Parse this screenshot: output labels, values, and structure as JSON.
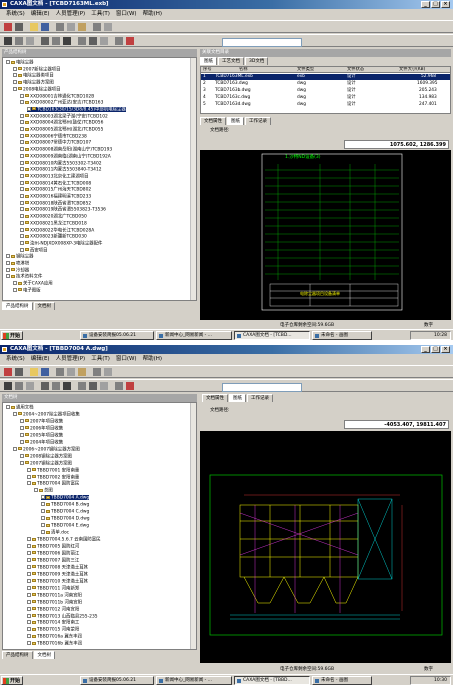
{
  "s1": {
    "title": "CAXA图文档 - [TCBD7163ML.exb]",
    "menu": [
      "系统(S)",
      "编辑(E)",
      "人员管理(P)",
      "工具(T)",
      "窗口(W)",
      "帮助(H)"
    ],
    "tree_title": "产品结构树",
    "tree": [
      "电除尘器",
      "2007新除尘器项目",
      "电除尘器类项目",
      "电除尘器方案图",
      "2008电除尘器项目",
      "XXD08001吉林通化TCBD102B",
      "XXD08002广州亚达(安吉)TCBD163",
      "TCBD163(30/15/3D8/8.45)中部机电除尘器",
      "XXD08003湖北梁子湖(宁安)TCBD102",
      "XXD08004湖北鄂州(鼓仗)TCBD056",
      "XXD08005湖北鄂州(湖北)TCBD055",
      "XXD08006宁德市TCBD238",
      "XXD08007常德中力TCBD107",
      "XXD08008湖南岳阳(湖南山宁)TCBD193",
      "XXD08009湖南临(湖南山宁)TCBD192A",
      "XXD08010内蒙古5503302-T3402",
      "XXD08011内蒙古5503840-T3412",
      "XXD08013北京化工建湖项目",
      "XXD08014黄石化工TCBD008",
      "XXD08015广州海天TCBD802",
      "XXD08016福建明溪TCBD233",
      "XXD08018陕西省渭TCBD852",
      "XXD08019陕西省渭5503823-T3536",
      "XXD08020湖北广TCBD050",
      "XXD08021黑龙江TCBD018",
      "XXD08022华电长江TCBD028A",
      "XXD08023新疆新TCBD030",
      "汝州-NDJXDX008XP-3电除尘器配件",
      "西安项目",
      "钢除尘器",
      "喷淋塔",
      "冷却器",
      "技术资料文件",
      "关于CAXA应用",
      "电子图版"
    ],
    "btabs": [
      "产品结构树",
      "文档树"
    ],
    "pane_title": "关联文档目录",
    "tabs_top": [
      "图纸",
      "工艺文档",
      "3D文档"
    ],
    "cols": [
      "序号",
      "名称",
      "文件类型",
      "文件状态",
      "文件大小(KB)"
    ],
    "rows": [
      [
        "1",
        "TCBD7163ML.exb",
        "exb",
        "设计",
        "52.968"
      ],
      [
        "2",
        "TCBD7163.dwg",
        "dwg",
        "设计",
        "1609.395"
      ],
      [
        "3",
        "TCBD7163b.dwg",
        "dwg",
        "设计",
        "205.243"
      ],
      [
        "4",
        "TCBD7163c.dwg",
        "dwg",
        "设计",
        "134.983"
      ],
      [
        "5",
        "TCBD7163d.dwg",
        "dwg",
        "设计",
        "247.401"
      ]
    ],
    "view_tabs": [
      "文档属性",
      "图纸",
      "工作记录"
    ],
    "path_label": "文档路径:",
    "coord": "1075.602, 1286.399",
    "drawing_title": "1.沙特ND设备(3)",
    "drawing_sub": "电除尘器项目设备清单",
    "status": "电子仓库剩余空间:59.6GB",
    "capslock": "数字",
    "taskbar": {
      "start": "开始",
      "tasks": [
        "设备安装简报05.06.21",
        "新闻中心_网易新闻 - ...",
        "CAXA图文档 - [TCBD...",
        "未命名 - 画图"
      ],
      "time": "10:28"
    }
  },
  "s2": {
    "title": "CAXA图文档 - [TBBD7004 A.dwg]",
    "menu": [
      "系统(S)",
      "编辑(E)",
      "人员管理(P)",
      "工具(T)",
      "窗口(W)",
      "帮助(H)"
    ],
    "tree_title": "文档树",
    "tree": [
      "通用文档",
      "2004~2007除尘器项目收集",
      "2007年项目收集",
      "2006年项目收集",
      "2005年项目收集",
      "2004年项目收集",
      "2006~2007钢除尘器方案图",
      "2008钢除尘器方案图",
      "2007钢除尘器方案图",
      "TBBD7001 安阳南重",
      "TBBD7002 安阳南重",
      "TBBD7004 国防富民",
      "总图",
      "TBBD7004 A.dwg",
      "TBBD7004 B.dwg",
      "TBBD7004 C.dwg",
      "TBBD7004 D.dwg",
      "TBBD7004 E.dwg",
      "清单.doc",
      "TBBD7004.5.6.7 云南国防富民",
      "TBBD7005 国防红河",
      "TBBD7006 国防丽江",
      "TBBD7007 国防三江",
      "TBBD7008 天津渤土耳其",
      "TBBD7009 天津渤土耳其",
      "TBBD7010 天津渤土耳其",
      "TBBD7011 河南新郑",
      "TBBD7011a 河南宜阳",
      "TBBD7011b 河南宜阳",
      "TBBD7012 河南宜阳",
      "TBBD7013 山西临县255-235",
      "TBBD7014 安阳南工",
      "TBBD7015 河南荥阳",
      "TBBD7016a 冀东丰润",
      "TBBD7016b 冀东丰润"
    ],
    "btabs": [
      "产品结构树",
      "文档树"
    ],
    "view_tabs": [
      "文档属性",
      "图纸",
      "工作记录"
    ],
    "path_label": "文档路径:",
    "coord": "-4053.407, 19811.407",
    "status": "电子仓库剩余空间:59.6GB",
    "capslock": "数字",
    "taskbar": {
      "start": "开始",
      "tasks": [
        "设备安装简报05.06.21",
        "新闻中心_网易新闻 - ...",
        "CAXA图文档 - [TBBD...",
        "未命名 - 画图"
      ],
      "time": "10:30"
    }
  }
}
